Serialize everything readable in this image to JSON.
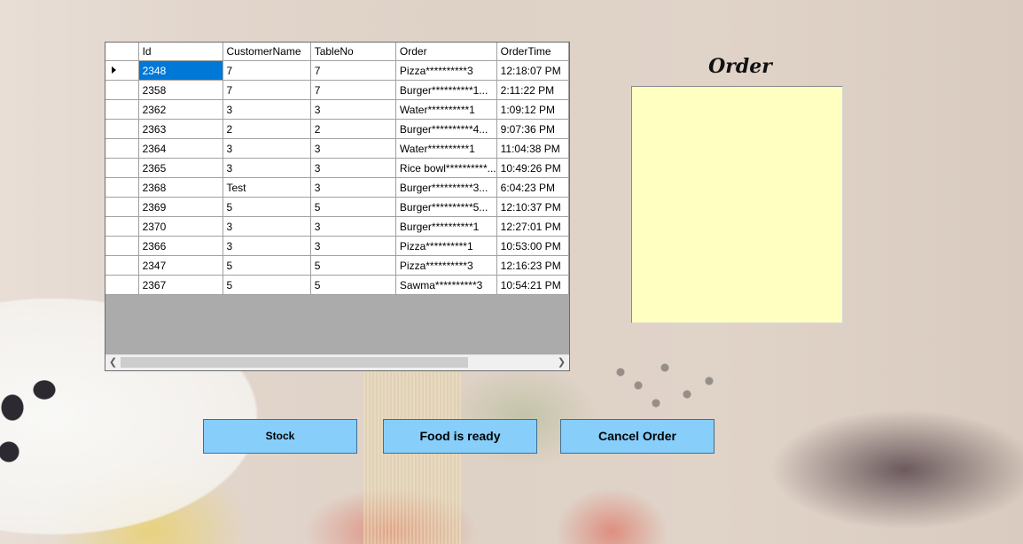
{
  "grid": {
    "columns": [
      "Id",
      "CustomerName",
      "TableNo",
      "Order",
      "OrderTime"
    ],
    "rows": [
      [
        "2348",
        "7",
        "7",
        "Pizza**********3",
        "12:18:07 PM"
      ],
      [
        "2358",
        "7",
        "7",
        "Burger**********1...",
        "2:11:22 PM"
      ],
      [
        "2362",
        "3",
        "3",
        "Water**********1",
        "1:09:12 PM"
      ],
      [
        "2363",
        "2",
        "2",
        "Burger**********4...",
        "9:07:36 PM"
      ],
      [
        "2364",
        "3",
        "3",
        "Water**********1",
        "11:04:38 PM"
      ],
      [
        "2365",
        "3",
        "3",
        "Rice bowl**********...",
        "10:49:26 PM"
      ],
      [
        "2368",
        "Test",
        "3",
        "Burger**********3...",
        "6:04:23 PM"
      ],
      [
        "2369",
        "5",
        "5",
        "Burger**********5...",
        "12:10:37 PM"
      ],
      [
        "2370",
        "3",
        "3",
        "Burger**********1",
        "12:27:01 PM"
      ],
      [
        "2366",
        "3",
        "3",
        "Pizza**********1",
        "10:53:00 PM"
      ],
      [
        "2347",
        "5",
        "5",
        "Pizza**********3",
        "12:16:23 PM"
      ],
      [
        "2367",
        "5",
        "5",
        "Sawma**********3",
        "10:54:21 PM"
      ]
    ],
    "selected_row": 0,
    "selected_color": "#0078d7"
  },
  "order_panel": {
    "title": "Order",
    "text": "",
    "background": "#ffffc1"
  },
  "buttons": {
    "stock": "Stock",
    "food_ready": "Food is ready",
    "cancel_order": "Cancel Order",
    "color": "#87cefa"
  },
  "icons": {
    "row_pointer": "right-triangle",
    "scroll_left": "chevron-left",
    "scroll_right": "chevron-right"
  }
}
